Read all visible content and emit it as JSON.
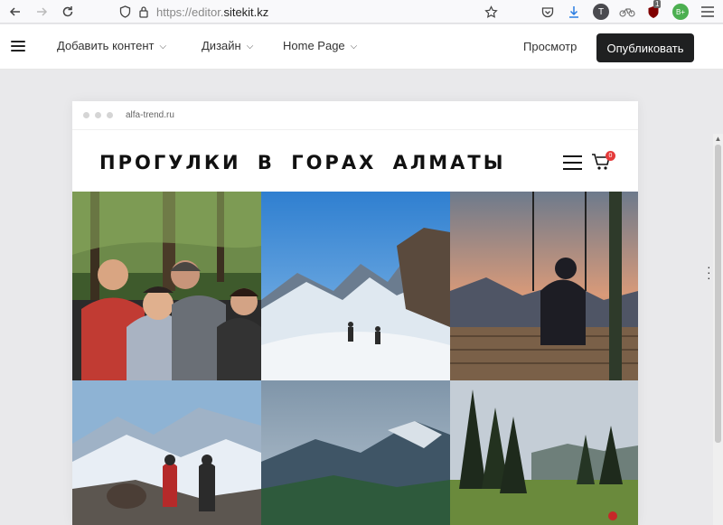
{
  "browser": {
    "url_prefix": "https://editor.",
    "url_domain": "sitekit.kz",
    "back_icon": "arrow-left-icon",
    "forward_icon": "arrow-right-icon",
    "reload_icon": "reload-icon",
    "ext_badge": "1",
    "avatar_letter": "T"
  },
  "editor": {
    "menu": [
      {
        "label": "Добавить контент"
      },
      {
        "label": "Дизайн"
      },
      {
        "label": "Home Page"
      }
    ],
    "preview_label": "Просмотр",
    "publish_label": "Опубликовать"
  },
  "canvas": {
    "mock_url": "alfa-trend.ru",
    "site_title": "ПРОГУЛКИ В ГОРАХ АЛМАТЫ",
    "cart_count": "0",
    "photos": [
      {
        "name": "group-of-hikers-photo",
        "scene": "forest-group"
      },
      {
        "name": "snowy-mountain-trail-photo",
        "scene": "snow-trail"
      },
      {
        "name": "sunset-swing-photo",
        "scene": "swing"
      },
      {
        "name": "hikers-on-ridge-photo",
        "scene": "ridge"
      },
      {
        "name": "cloudy-valley-photo",
        "scene": "valley"
      },
      {
        "name": "pine-forest-meadow-photo",
        "scene": "meadow"
      }
    ]
  },
  "colors": {
    "publish_bg": "#1f2021",
    "cart_badge": "#e53b3b",
    "canvas_bg": "#e9e9eb"
  }
}
